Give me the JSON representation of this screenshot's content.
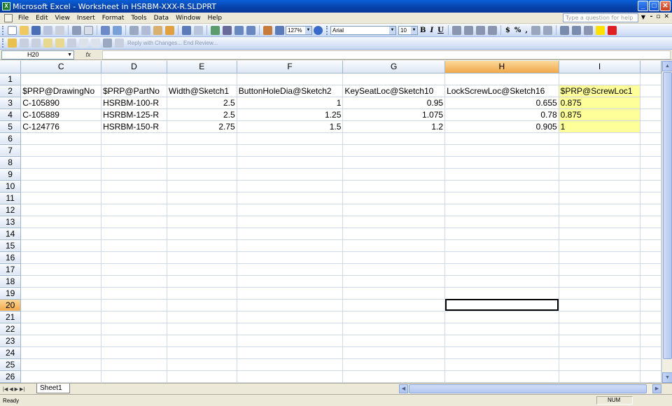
{
  "window": {
    "title": "Microsoft Excel - Worksheet in HSRBM-XXX-R.SLDPRT",
    "app_icon": "excel-icon"
  },
  "menu": {
    "items": [
      "File",
      "Edit",
      "View",
      "Insert",
      "Format",
      "Tools",
      "Data",
      "Window",
      "Help"
    ],
    "help_placeholder": "Type a question for help"
  },
  "toolbar": {
    "zoom": "127%",
    "font": "Arial",
    "font_size": "10",
    "bold": "B",
    "italic": "I",
    "underline": "U",
    "currency": "$",
    "percent": "%",
    "comma": ",",
    "review_text": "Reply with Changes... End Review..."
  },
  "formula": {
    "name_box": "H20",
    "fx": "fx",
    "content": ""
  },
  "grid": {
    "columns": [
      "C",
      "D",
      "E",
      "F",
      "G",
      "H",
      "I"
    ],
    "selected_column": "H",
    "selected_row": 20,
    "active_cell": "H20",
    "highlight_column": "I",
    "highlight_color": "#ffff99",
    "rows": [
      {
        "n": "1",
        "cells": [
          "",
          "",
          "",
          "",
          "",
          "",
          ""
        ]
      },
      {
        "n": "2",
        "cells": [
          "$PRP@DrawingNo",
          "$PRP@PartNo",
          "Width@Sketch1",
          "ButtonHoleDia@Sketch2",
          "KeySeatLoc@Sketch10",
          "LockScrewLoc@Sketch16",
          "$PRP@ScrewLoc1"
        ]
      },
      {
        "n": "3",
        "cells": [
          "C-105890",
          "HSRBM-100-R",
          "2.5",
          "1",
          "0.95",
          "0.655",
          "0.875"
        ]
      },
      {
        "n": "4",
        "cells": [
          "C-105889",
          "HSRBM-125-R",
          "2.5",
          "1.25",
          "1.075",
          "0.78",
          "0.875"
        ]
      },
      {
        "n": "5",
        "cells": [
          "C-124776",
          "HSRBM-150-R",
          "2.75",
          "1.5",
          "1.2",
          "0.905",
          "1"
        ]
      },
      {
        "n": "6",
        "cells": [
          "",
          "",
          "",
          "",
          "",
          "",
          ""
        ]
      },
      {
        "n": "7",
        "cells": [
          "",
          "",
          "",
          "",
          "",
          "",
          ""
        ]
      },
      {
        "n": "8",
        "cells": [
          "",
          "",
          "",
          "",
          "",
          "",
          ""
        ]
      },
      {
        "n": "9",
        "cells": [
          "",
          "",
          "",
          "",
          "",
          "",
          ""
        ]
      },
      {
        "n": "10",
        "cells": [
          "",
          "",
          "",
          "",
          "",
          "",
          ""
        ]
      },
      {
        "n": "11",
        "cells": [
          "",
          "",
          "",
          "",
          "",
          "",
          ""
        ]
      },
      {
        "n": "12",
        "cells": [
          "",
          "",
          "",
          "",
          "",
          "",
          ""
        ]
      },
      {
        "n": "13",
        "cells": [
          "",
          "",
          "",
          "",
          "",
          "",
          ""
        ]
      },
      {
        "n": "14",
        "cells": [
          "",
          "",
          "",
          "",
          "",
          "",
          ""
        ]
      },
      {
        "n": "15",
        "cells": [
          "",
          "",
          "",
          "",
          "",
          "",
          ""
        ]
      },
      {
        "n": "16",
        "cells": [
          "",
          "",
          "",
          "",
          "",
          "",
          ""
        ]
      },
      {
        "n": "17",
        "cells": [
          "",
          "",
          "",
          "",
          "",
          "",
          ""
        ]
      },
      {
        "n": "18",
        "cells": [
          "",
          "",
          "",
          "",
          "",
          "",
          ""
        ]
      },
      {
        "n": "19",
        "cells": [
          "",
          "",
          "",
          "",
          "",
          "",
          ""
        ]
      },
      {
        "n": "20",
        "cells": [
          "",
          "",
          "",
          "",
          "",
          "",
          ""
        ]
      },
      {
        "n": "21",
        "cells": [
          "",
          "",
          "",
          "",
          "",
          "",
          ""
        ]
      },
      {
        "n": "22",
        "cells": [
          "",
          "",
          "",
          "",
          "",
          "",
          ""
        ]
      },
      {
        "n": "23",
        "cells": [
          "",
          "",
          "",
          "",
          "",
          "",
          ""
        ]
      },
      {
        "n": "24",
        "cells": [
          "",
          "",
          "",
          "",
          "",
          "",
          ""
        ]
      },
      {
        "n": "25",
        "cells": [
          "",
          "",
          "",
          "",
          "",
          "",
          ""
        ]
      },
      {
        "n": "26",
        "cells": [
          "",
          "",
          "",
          "",
          "",
          "",
          ""
        ]
      }
    ]
  },
  "sheets": {
    "tabs": [
      "Sheet1"
    ]
  },
  "status": {
    "left": "Ready",
    "num": "NUM"
  }
}
